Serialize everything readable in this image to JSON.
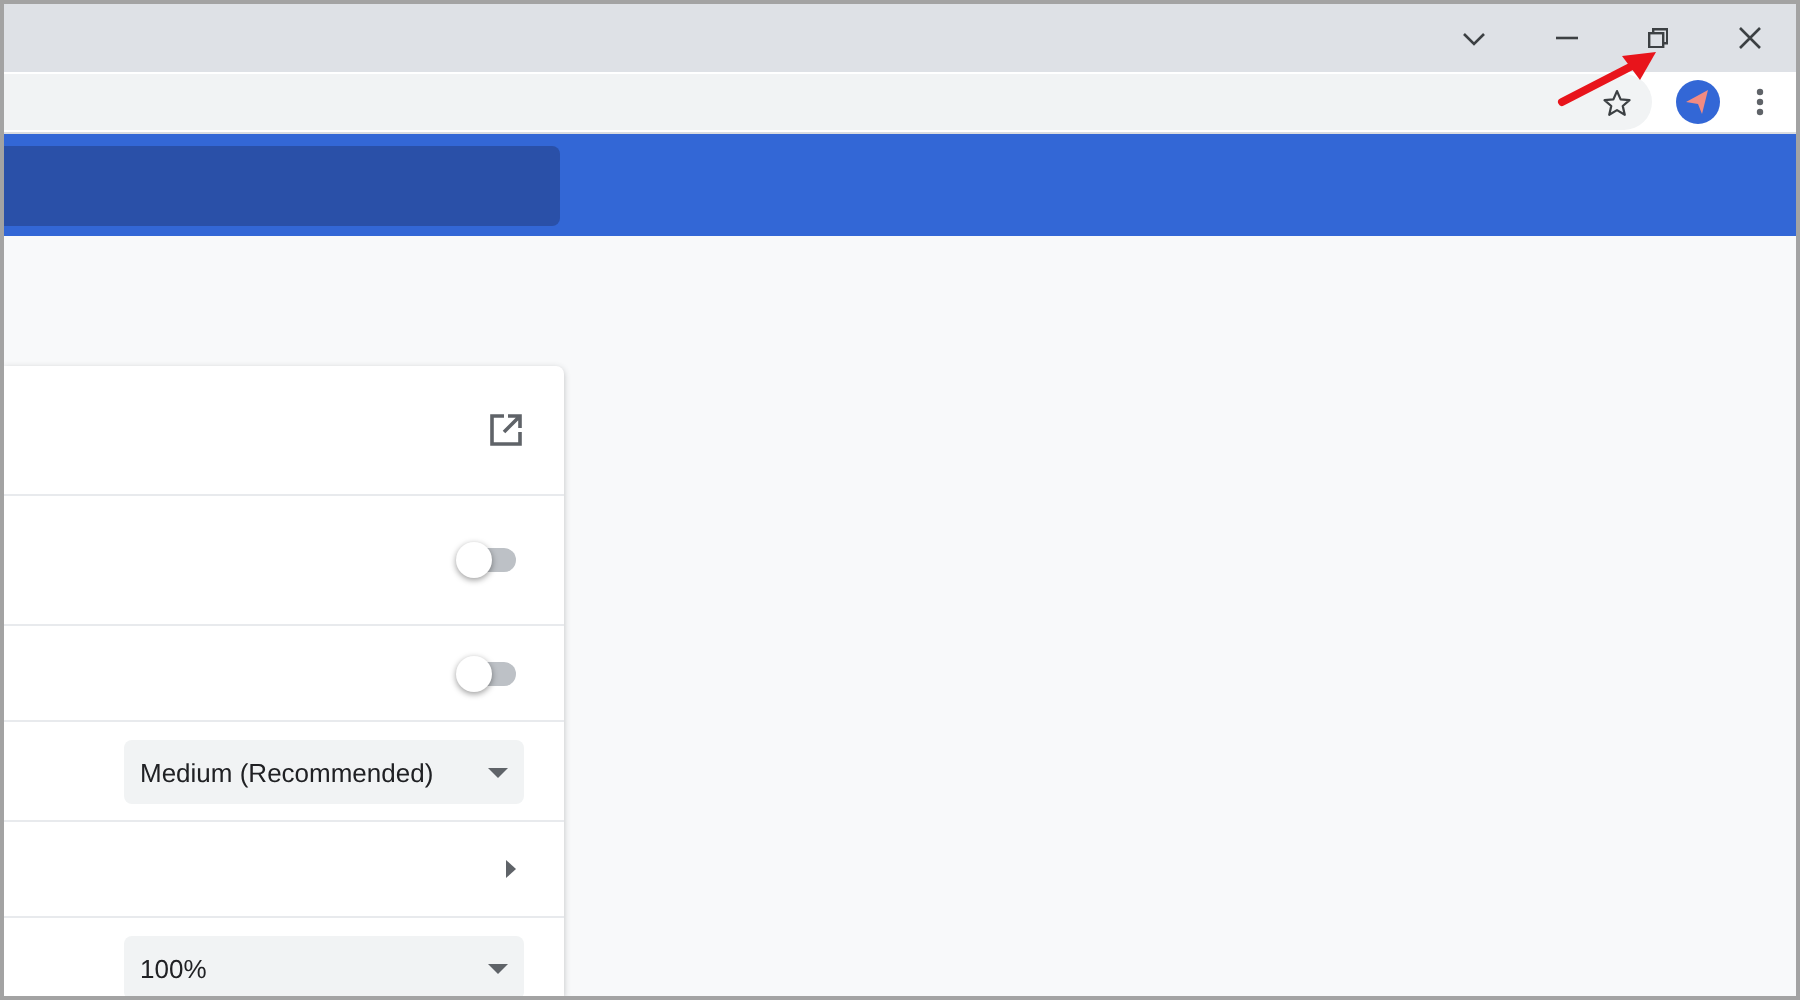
{
  "titlebar": {
    "controls": [
      {
        "kind": "tab-search"
      },
      {
        "kind": "minimize"
      },
      {
        "kind": "restore"
      },
      {
        "kind": "close"
      }
    ]
  },
  "toolbar": {
    "bookmarked": false
  },
  "annotation": {
    "kind": "arrow",
    "color": "#e8141b"
  },
  "settings_rows": [
    {
      "kind": "link"
    },
    {
      "kind": "toggle",
      "on": false
    },
    {
      "kind": "toggle",
      "on": false
    },
    {
      "kind": "select",
      "value": "Medium (Recommended)"
    },
    {
      "kind": "submenu"
    },
    {
      "kind": "select",
      "value": "100%"
    }
  ]
}
